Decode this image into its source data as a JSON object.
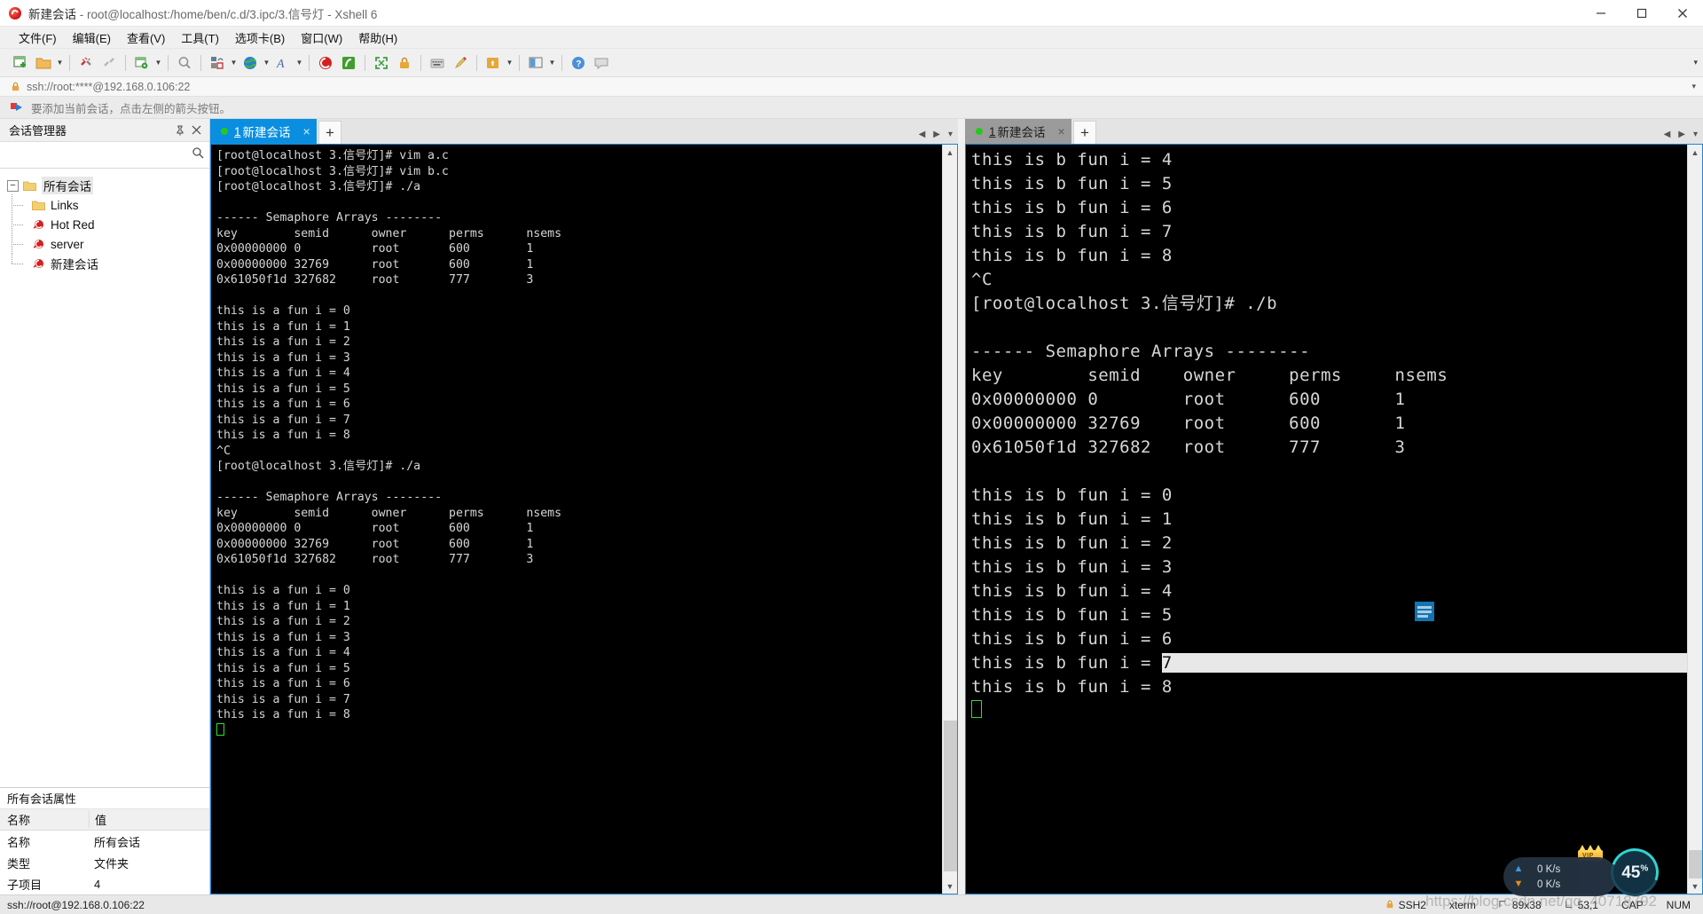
{
  "window": {
    "title_main": "新建会话",
    "title_rest": " - root@localhost:/home/ben/c.d/3.ipc/3.信号灯 - Xshell 6",
    "app_icon": "xshell-icon",
    "minimize": "minimize-icon",
    "maximize": "maximize-icon",
    "close": "close-icon"
  },
  "menu": {
    "items": [
      {
        "label": "文件(F)",
        "name": "menu-file"
      },
      {
        "label": "编辑(E)",
        "name": "menu-edit"
      },
      {
        "label": "查看(V)",
        "name": "menu-view"
      },
      {
        "label": "工具(T)",
        "name": "menu-tools"
      },
      {
        "label": "选项卡(B)",
        "name": "menu-tabs"
      },
      {
        "label": "窗口(W)",
        "name": "menu-window"
      },
      {
        "label": "帮助(H)",
        "name": "menu-help"
      }
    ]
  },
  "toolbar": {
    "overflow": "▾",
    "icons": [
      "new-session-icon",
      "open-folder-icon",
      "folder-dropdown-caret",
      "disconnect-icon",
      "reconnect-icon",
      "session-properties-icon",
      "properties-dropdown-caret",
      "find-icon",
      "transfer-icon",
      "transfer-dropdown-caret",
      "globe-icon",
      "globe-dropdown-caret",
      "font-icon",
      "font-dropdown-caret",
      "xshell-icon",
      "xftp-icon",
      "fullscreen-icon",
      "lock-icon",
      "keyboard-icon",
      "highlight-icon",
      "compose-icon",
      "compose-dropdown-caret",
      "layout-icon",
      "layout-dropdown-caret",
      "help-icon",
      "feedback-icon"
    ]
  },
  "address": {
    "value": "ssh://root:****@192.168.0.106:22",
    "lock_icon": "lock-icon",
    "caret": "▾"
  },
  "notice": {
    "icon": "arrow-flag-icon",
    "text": "要添加当前会话，点击左侧的箭头按钮。"
  },
  "sidebar": {
    "header_title": "会话管理器",
    "pin_icon": "pin-icon",
    "close_icon": "close-icon",
    "search": {
      "value": "",
      "placeholder": "",
      "icon": "search-icon"
    },
    "tree": [
      {
        "label": "所有会话",
        "icon": "folder-icon",
        "level": 0,
        "selected": true,
        "name": "tree-node-all-sessions"
      },
      {
        "label": "Links",
        "icon": "folder-icon",
        "level": 1,
        "selected": false,
        "name": "tree-node-links"
      },
      {
        "label": "Hot Red",
        "icon": "session-icon",
        "level": 1,
        "selected": false,
        "name": "tree-node-hot-red"
      },
      {
        "label": "server",
        "icon": "session-icon",
        "level": 1,
        "selected": false,
        "name": "tree-node-server"
      },
      {
        "label": "新建会话",
        "icon": "session-icon",
        "level": 1,
        "selected": false,
        "name": "tree-node-new-session"
      }
    ],
    "properties": {
      "title": "所有会话属性",
      "columns": [
        "名称",
        "值"
      ],
      "rows": [
        {
          "name": "名称",
          "value": "所有会话"
        },
        {
          "name": "类型",
          "value": "文件夹"
        },
        {
          "name": "子项目",
          "value": "4"
        }
      ]
    }
  },
  "panes": {
    "left": {
      "tab": {
        "num": "1",
        "label": "新建会话",
        "close": "×",
        "status_dot": "#27c81e"
      },
      "add_tab": "+",
      "nav": {
        "prev": "◀",
        "next": "▶",
        "menu": "▾"
      },
      "lines": [
        "[root@localhost 3.信号灯]# vim a.c",
        "[root@localhost 3.信号灯]# vim b.c",
        "[root@localhost 3.信号灯]# ./a",
        "",
        "------ Semaphore Arrays --------",
        "key        semid      owner      perms      nsems",
        "0x00000000 0          root       600        1",
        "0x00000000 32769      root       600        1",
        "0x61050f1d 327682     root       777        3",
        "",
        "this is a fun i = 0",
        "this is a fun i = 1",
        "this is a fun i = 2",
        "this is a fun i = 3",
        "this is a fun i = 4",
        "this is a fun i = 5",
        "this is a fun i = 6",
        "this is a fun i = 7",
        "this is a fun i = 8",
        "^C",
        "[root@localhost 3.信号灯]# ./a",
        "",
        "------ Semaphore Arrays --------",
        "key        semid      owner      perms      nsems",
        "0x00000000 0          root       600        1",
        "0x00000000 32769      root       600        1",
        "0x61050f1d 327682     root       777        3",
        "",
        "this is a fun i = 0",
        "this is a fun i = 1",
        "this is a fun i = 2",
        "this is a fun i = 3",
        "this is a fun i = 4",
        "this is a fun i = 5",
        "this is a fun i = 6",
        "this is a fun i = 7",
        "this is a fun i = 8"
      ]
    },
    "right": {
      "tab": {
        "num": "1",
        "label": "新建会话",
        "close": "×",
        "status_dot": "#27c81e"
      },
      "add_tab": "+",
      "nav": {
        "prev": "◀",
        "next": "▶",
        "menu": "▾"
      },
      "lines": [
        "this is b fun i = 4",
        "this is b fun i = 5",
        "this is b fun i = 6",
        "this is b fun i = 7",
        "this is b fun i = 8",
        "^C",
        "[root@localhost 3.信号灯]# ./b",
        "",
        "------ Semaphore Arrays --------",
        "key        semid    owner     perms     nsems",
        "0x00000000 0        root      600       1",
        "0x00000000 32769    root      600       1",
        "0x61050f1d 327682   root      777       3",
        "",
        "this is b fun i = 0",
        "this is b fun i = 1",
        "this is b fun i = 2",
        "this is b fun i = 3",
        "this is b fun i = 4",
        "this is b fun i = 5",
        "this is b fun i = 6"
      ],
      "selected_line_prefix": "this is b fun i = ",
      "selected_line_value": "7",
      "last_line": "this is b fun i = 8",
      "doc_icon": "document-icon"
    }
  },
  "speed_widget": {
    "upload": "0 K/s",
    "download": "0 K/s",
    "percent": "45",
    "percent_sign": "%",
    "badge": "VIP",
    "up_arrow": "▲",
    "down_arrow": "▼"
  },
  "watermark": "https://blog.csdn.net/qq_40718792",
  "statusbar": {
    "connection": "ssh://root@192.168.0.106:22",
    "protocol": "SSH2",
    "terminal": "xterm",
    "size": "89x38",
    "cursor": "53,1",
    "caps": "CAP",
    "num": "NUM",
    "lock_icon": "lock-icon",
    "size_icon": "resize-icon",
    "cursor_icon": "cursor-icon"
  }
}
